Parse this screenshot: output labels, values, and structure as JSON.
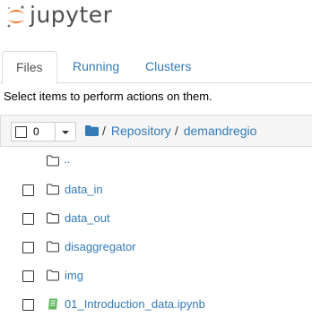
{
  "app": {
    "name": "jupyter"
  },
  "tabs": [
    {
      "label": "Files",
      "active": true
    },
    {
      "label": "Running",
      "active": false
    },
    {
      "label": "Clusters",
      "active": false
    }
  ],
  "hint": "Select items to perform actions on them.",
  "selection": {
    "count": "0"
  },
  "breadcrumb": {
    "items": [
      "Repository",
      "demandregio"
    ],
    "separator": "/"
  },
  "entries": [
    {
      "name": "..",
      "type": "up"
    },
    {
      "name": "data_in",
      "type": "folder"
    },
    {
      "name": "data_out",
      "type": "folder"
    },
    {
      "name": "disaggregator",
      "type": "folder"
    },
    {
      "name": "img",
      "type": "folder"
    },
    {
      "name": "01_Introduction_data.ipynb",
      "type": "notebook"
    }
  ],
  "colors": {
    "link": "#337ab7",
    "logo_orange": "#f37726",
    "notebook_green": "#5cb85c"
  }
}
